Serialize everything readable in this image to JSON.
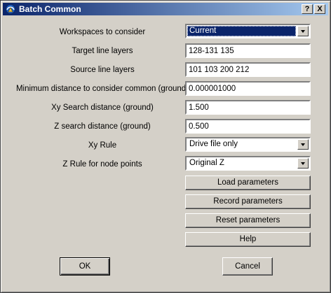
{
  "window": {
    "title": "Batch Common",
    "help_glyph": "?",
    "close_glyph": "X"
  },
  "form": {
    "workspaces_label": "Workspaces to consider",
    "workspaces_value": "Current",
    "target_label": "Target line layers",
    "target_value": "128-131 135",
    "source_label": "Source line layers",
    "source_value": "101 103 200 212",
    "mindist_label": "Minimum distance to consider common (ground)",
    "mindist_value": "0.000001000",
    "xysearch_label": "Xy Search distance (ground)",
    "xysearch_value": "1.500",
    "zsearch_label": "Z search distance (ground)",
    "zsearch_value": "0.500",
    "xyrule_label": "Xy Rule",
    "xyrule_value": "Drive file only",
    "zrule_label": "Z Rule for node points",
    "zrule_value": "Original Z"
  },
  "buttons": {
    "load": "Load parameters",
    "record": "Record parameters",
    "reset": "Reset parameters",
    "help": "Help",
    "ok": "OK",
    "cancel": "Cancel"
  }
}
